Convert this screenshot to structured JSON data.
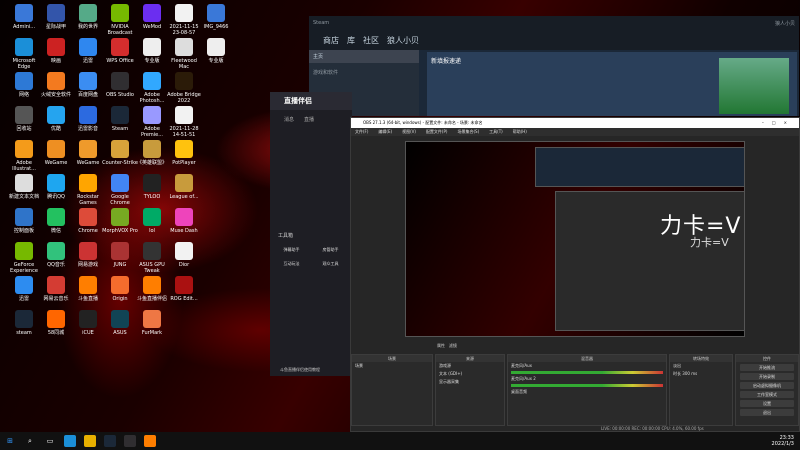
{
  "desktop": {
    "icons": [
      {
        "label": "Admini...",
        "c": "#3a78d8",
        "col": 0,
        "row": 0
      },
      {
        "label": "Microsoft Edge",
        "c": "#1b8fd8",
        "col": 0,
        "row": 1
      },
      {
        "label": "网络",
        "c": "#2d79d6",
        "col": 0,
        "row": 2
      },
      {
        "label": "回收站",
        "c": "#555",
        "col": 0,
        "row": 3
      },
      {
        "label": "Adobe Illustrat...",
        "c": "#f49b1a",
        "col": 0,
        "row": 4
      },
      {
        "label": "新建文本文档",
        "c": "#ddd",
        "col": 0,
        "row": 5
      },
      {
        "label": "控制面板",
        "c": "#2f74c9",
        "col": 0,
        "row": 6
      },
      {
        "label": "GeForce Experience",
        "c": "#76b900",
        "col": 0,
        "row": 7
      },
      {
        "label": "迅雷",
        "c": "#2d8cf0",
        "col": 0,
        "row": 8
      },
      {
        "label": "steam",
        "c": "#1b2838",
        "col": 0,
        "row": 9
      },
      {
        "label": "星际战甲",
        "c": "#3355aa",
        "col": 1,
        "row": 0
      },
      {
        "label": "映画",
        "c": "#c22",
        "col": 1,
        "row": 1
      },
      {
        "label": "火绒安全软件",
        "c": "#f37a1f",
        "col": 1,
        "row": 2
      },
      {
        "label": "优酷",
        "c": "#25a4ef",
        "col": 1,
        "row": 3
      },
      {
        "label": "WeGame",
        "c": "#ee8f22",
        "col": 1,
        "row": 4
      },
      {
        "label": "腾讯QQ",
        "c": "#1ea6f0",
        "col": 1,
        "row": 5
      },
      {
        "label": "微信",
        "c": "#23c160",
        "col": 1,
        "row": 6
      },
      {
        "label": "QQ音乐",
        "c": "#31c27c",
        "col": 1,
        "row": 7
      },
      {
        "label": "网易云音乐",
        "c": "#d43c33",
        "col": 1,
        "row": 8
      },
      {
        "label": "58同城",
        "c": "#f60",
        "col": 1,
        "row": 9
      },
      {
        "label": "我的世界",
        "c": "#5a8",
        "col": 2,
        "row": 0
      },
      {
        "label": "迅雷",
        "c": "#2f87ef",
        "col": 2,
        "row": 1
      },
      {
        "label": "百度网盘",
        "c": "#3b8df2",
        "col": 2,
        "row": 2
      },
      {
        "label": "迅雷影音",
        "c": "#2c6ae0",
        "col": 2,
        "row": 3
      },
      {
        "label": "WeGame",
        "c": "#ef9a2b",
        "col": 2,
        "row": 4
      },
      {
        "label": "Rockstar Games",
        "c": "#ffa500",
        "col": 2,
        "row": 5
      },
      {
        "label": "Chrome",
        "c": "#dd4b39",
        "col": 2,
        "row": 6
      },
      {
        "label": "网易游戏",
        "c": "#c33",
        "col": 2,
        "row": 7
      },
      {
        "label": "斗鱼直播",
        "c": "#ff7e00",
        "col": 2,
        "row": 8
      },
      {
        "label": "iCUE",
        "c": "#222",
        "col": 2,
        "row": 9
      },
      {
        "label": "NVIDIA Broadcast",
        "c": "#76b900",
        "col": 3,
        "row": 0
      },
      {
        "label": "WPS Office",
        "c": "#d42d2d",
        "col": 3,
        "row": 1
      },
      {
        "label": "OBS Studio",
        "c": "#302e31",
        "col": 3,
        "row": 2
      },
      {
        "label": "Steam",
        "c": "#1b2838",
        "col": 3,
        "row": 3
      },
      {
        "label": "Counter-Strike",
        "c": "#d8a23a",
        "col": 3,
        "row": 4
      },
      {
        "label": "Google Chrome",
        "c": "#4285f4",
        "col": 3,
        "row": 5
      },
      {
        "label": "MorphVOX Pro",
        "c": "#7a2",
        "col": 3,
        "row": 6
      },
      {
        "label": "JUNG",
        "c": "#a33",
        "col": 3,
        "row": 7
      },
      {
        "label": "Origin",
        "c": "#f56c2d",
        "col": 3,
        "row": 8
      },
      {
        "label": "ASUS",
        "c": "#145",
        "col": 3,
        "row": 9
      },
      {
        "label": "WeMod",
        "c": "#6b2ef0",
        "col": 4,
        "row": 0
      },
      {
        "label": "专业版",
        "c": "#eee",
        "col": 4,
        "row": 1
      },
      {
        "label": "Adobe Photosh...",
        "c": "#31a8ff",
        "col": 4,
        "row": 2
      },
      {
        "label": "Adobe Premie...",
        "c": "#9999ff",
        "col": 4,
        "row": 3
      },
      {
        "label": "《英雄联盟》",
        "c": "#c89b3c",
        "col": 4,
        "row": 4
      },
      {
        "label": "TYLOO",
        "c": "#222",
        "col": 4,
        "row": 5
      },
      {
        "label": "lol",
        "c": "#0a6",
        "col": 4,
        "row": 6
      },
      {
        "label": "ASUS GPU Tweak",
        "c": "#333",
        "col": 4,
        "row": 7
      },
      {
        "label": "斗鱼直播伴侣",
        "c": "#ff7e00",
        "col": 4,
        "row": 8
      },
      {
        "label": "FurMark",
        "c": "#e74",
        "col": 4,
        "row": 9
      },
      {
        "label": "2021-11-15 23-08-57",
        "c": "#f2f2f2",
        "col": 5,
        "row": 0
      },
      {
        "label": "Fleetwood Mac",
        "c": "#ddd",
        "col": 5,
        "row": 1
      },
      {
        "label": "Adobe Bridge 2022",
        "c": "#2b1b08",
        "col": 5,
        "row": 2
      },
      {
        "label": "2021-11-28 14-51-51",
        "c": "#f2f2f2",
        "col": 5,
        "row": 3
      },
      {
        "label": "PotPlayer",
        "c": "#ffc20e",
        "col": 5,
        "row": 4
      },
      {
        "label": "League of...",
        "c": "#c89b3c",
        "col": 5,
        "row": 5
      },
      {
        "label": "Muse Dash",
        "c": "#e4b",
        "col": 5,
        "row": 6
      },
      {
        "label": "Dior",
        "c": "#f2f2f2",
        "col": 5,
        "row": 7
      },
      {
        "label": "ROG Edit...",
        "c": "#a11",
        "col": 5,
        "row": 8
      },
      {
        "label": "IMG_9466",
        "c": "#3a78d8",
        "col": 6,
        "row": 0
      },
      {
        "label": "专业版",
        "c": "#eee",
        "col": 6,
        "row": 1
      }
    ]
  },
  "steam": {
    "title": "Steam",
    "nav": [
      "商店",
      "库",
      "社区",
      "狼人小贝"
    ],
    "home": "主页",
    "games": "游戏和软件",
    "banner": "新填报速递",
    "user": "狼人小贝"
  },
  "zhibo": {
    "title": "直播伴侣",
    "tabs": [
      "消息",
      "直播"
    ],
    "items": [
      "弹幕助手",
      "房管助手",
      "互动玩法",
      "观众工具"
    ],
    "tools": "工具箱",
    "tip": "斗鱼直播伴侣使用教程"
  },
  "obs": {
    "title": "OBS 27.1.3 (64-bit, windows) - 配置文件: 未命名 - 场景: 未命名",
    "menu": [
      "文件(F)",
      "编辑(E)",
      "视图(V)",
      "配置文件(P)",
      "场景集合(S)",
      "工具(T)",
      "帮助(H)"
    ],
    "scenes_title": "场景",
    "scene": "场景",
    "sources_title": "来源",
    "sources": [
      "游戏源",
      "文本 (GDI+)",
      "显示器采集"
    ],
    "mixer_title": "混音器",
    "mixer": [
      "麦克风/Aux",
      "麦克风/Aux 2",
      "桌面音频"
    ],
    "transition_title": "转场特效",
    "transition": "淡出",
    "duration_label": "时长",
    "duration": "300 ms",
    "controls_title": "控件",
    "controls": [
      "开始推流",
      "开始录制",
      "启动虚拟摄像机",
      "工作室模式",
      "设置",
      "退出"
    ],
    "status": "LIVE: 00:00:00  REC: 00:00:00  CPU: 4.0%, 60.00 fps",
    "props": "属性",
    "filters": "滤镜"
  },
  "overlay": {
    "big": "力卡=V",
    "small": "力卡=V"
  },
  "clock": {
    "time": "23:33",
    "date": "2022/1/3"
  }
}
